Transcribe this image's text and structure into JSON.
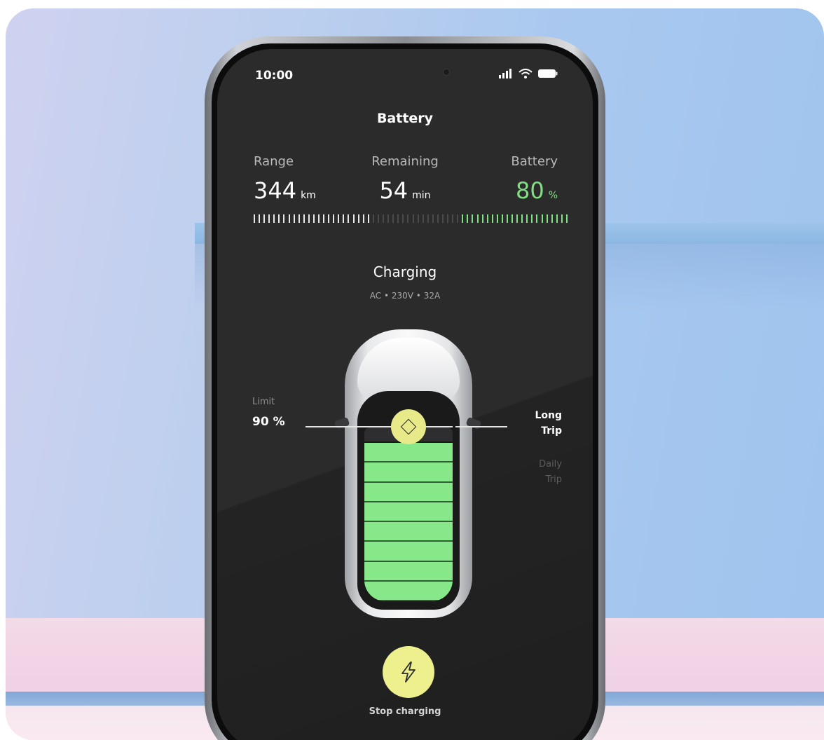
{
  "status_bar": {
    "time": "10:00",
    "icons": [
      "signal-icon",
      "wifi-icon",
      "battery-icon"
    ]
  },
  "header": {
    "title": "Battery"
  },
  "stats": {
    "range": {
      "label": "Range",
      "value": "344",
      "unit": "km"
    },
    "remaining": {
      "label": "Remaining",
      "value": "54",
      "unit": "min"
    },
    "battery": {
      "label": "Battery",
      "value": "80",
      "unit": "%"
    }
  },
  "charging": {
    "title": "Charging",
    "subtitle": "AC • 230V • 32A"
  },
  "limit": {
    "label": "Limit",
    "value": "90 %"
  },
  "trip_modes": {
    "long": {
      "line1": "Long",
      "line2": "Trip"
    },
    "daily": {
      "line1": "Daily",
      "line2": "Trip"
    }
  },
  "battery_level_fraction": 0.9,
  "actions": {
    "stop_label": "Stop charging"
  },
  "colors": {
    "accent_green": "#7ee081",
    "battery_cell": "#86e889",
    "knob_yellow": "#e8ea8a",
    "screen_bg": "#2b2b2c"
  }
}
